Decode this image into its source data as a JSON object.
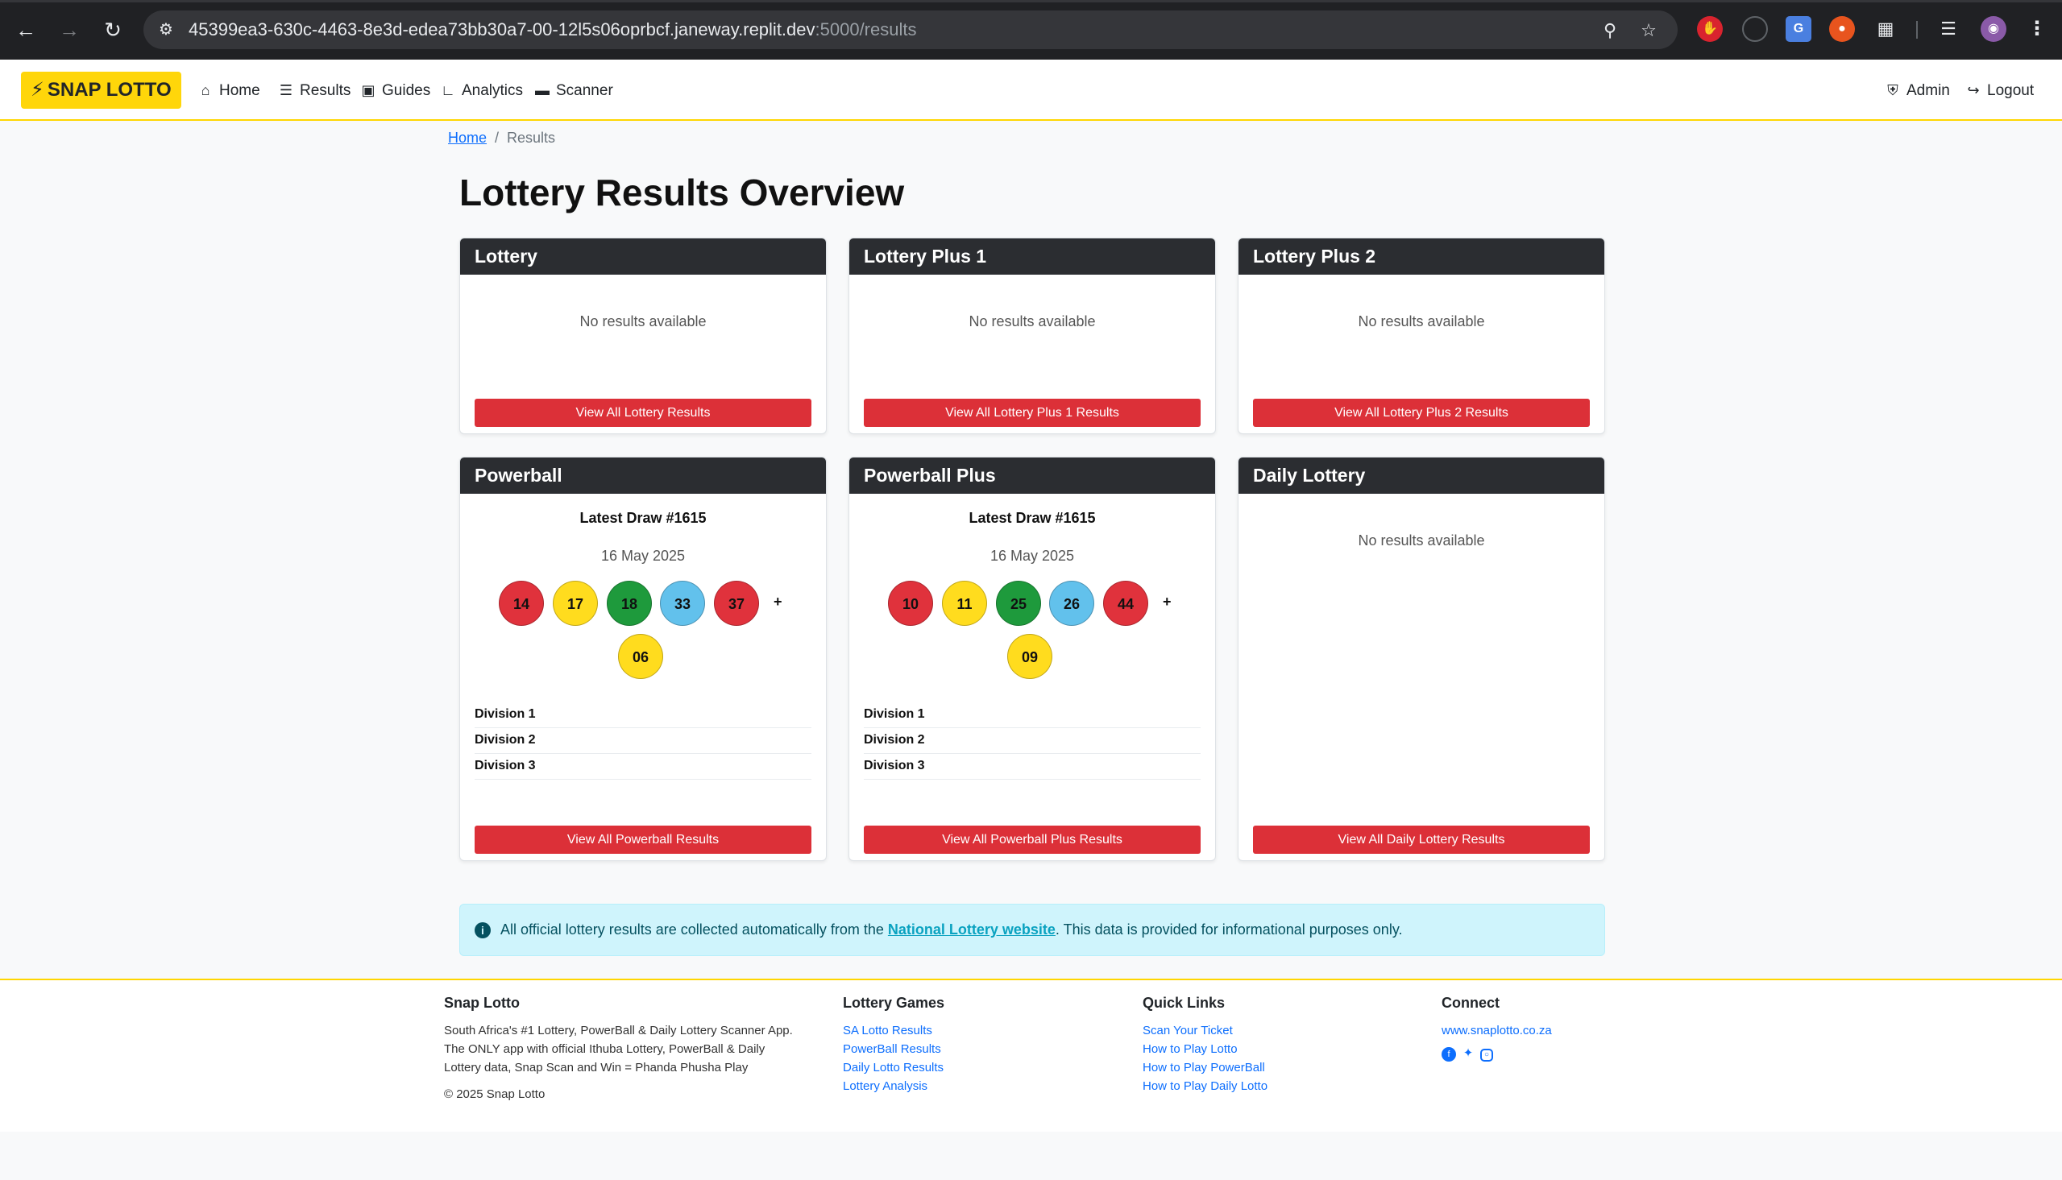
{
  "browser": {
    "url_main": "45399ea3-630c-4463-8e3d-edea73bb30a7-00-12l5s06oprbcf.janeway.replit.dev",
    "url_path": ":5000/results"
  },
  "navbar": {
    "brand": "SNAP LOTTO",
    "links": [
      {
        "label": "Home",
        "icon": "home-icon"
      },
      {
        "label": "Results",
        "icon": "list-icon"
      },
      {
        "label": "Guides",
        "icon": "book-icon"
      },
      {
        "label": "Analytics",
        "icon": "chart-icon"
      },
      {
        "label": "Scanner",
        "icon": "ticket-icon"
      }
    ],
    "admin": "Admin",
    "logout": "Logout"
  },
  "breadcrumb": {
    "home": "Home",
    "separator": "/",
    "current": "Results"
  },
  "page": {
    "title": "Lottery Results Overview"
  },
  "cards": {
    "lottery": {
      "title": "Lottery",
      "empty": "No results available",
      "button": "View All Lottery Results"
    },
    "lottery_plus_1": {
      "title": "Lottery Plus 1",
      "empty": "No results available",
      "button": "View All Lottery Plus 1 Results"
    },
    "lottery_plus_2": {
      "title": "Lottery Plus 2",
      "empty": "No results available",
      "button": "View All Lottery Plus 2 Results"
    },
    "powerball": {
      "title": "Powerball",
      "draw": "Latest Draw #1615",
      "date": "16 May 2025",
      "numbers": [
        "14",
        "17",
        "18",
        "33",
        "37"
      ],
      "plus": "+",
      "bonus": "06",
      "divisions": [
        "Division 1",
        "Division 2",
        "Division 3"
      ],
      "button": "View All Powerball Results"
    },
    "powerball_plus": {
      "title": "Powerball Plus",
      "draw": "Latest Draw #1615",
      "date": "16 May 2025",
      "numbers": [
        "10",
        "11",
        "25",
        "26",
        "44"
      ],
      "plus": "+",
      "bonus": "09",
      "divisions": [
        "Division 1",
        "Division 2",
        "Division 3"
      ],
      "button": "View All Powerball Plus Results"
    },
    "daily_lottery": {
      "title": "Daily Lottery",
      "empty": "No results available",
      "button": "View All Daily Lottery Results"
    }
  },
  "ball_colors": {
    "red": "#e0323c",
    "yellow": "#ffdc1e",
    "green": "#1e9a3c",
    "blue": "#62c1ec"
  },
  "info": {
    "text_before": "All official lottery results are collected automatically from the ",
    "link": "National Lottery website",
    "text_after": ". This data is provided for informational purposes only."
  },
  "footer": {
    "about_title": "Snap Lotto",
    "about_text": "South Africa's #1 Lottery, PowerBall & Daily Lottery Scanner App. The ONLY app with official Ithuba Lottery, PowerBall & Daily Lottery data, Snap Scan and Win = Phanda Phusha Play",
    "copyright": "© 2025 Snap Lotto",
    "games_title": "Lottery Games",
    "games": [
      "SA Lotto Results",
      "PowerBall Results",
      "Daily Lotto Results",
      "Lottery Analysis"
    ],
    "quick_title": "Quick Links",
    "quick": [
      "Scan Your Ticket",
      "How to Play Lotto",
      "How to Play PowerBall",
      "How to Play Daily Lotto"
    ],
    "connect_title": "Connect",
    "website": "www.snaplotto.co.za",
    "socials": [
      "facebook-icon",
      "twitter-icon",
      "instagram-icon"
    ]
  }
}
